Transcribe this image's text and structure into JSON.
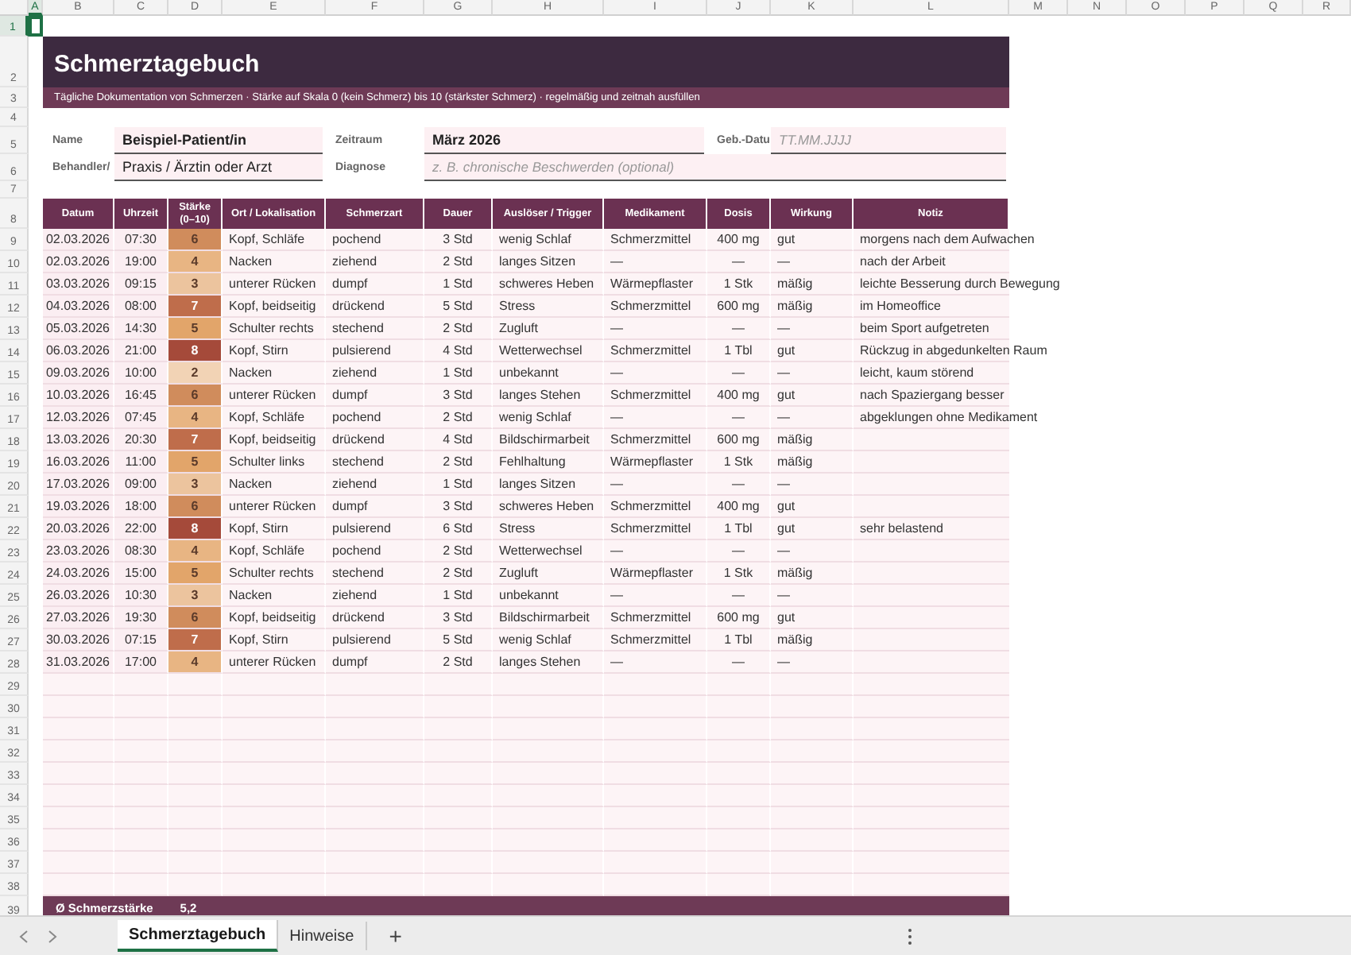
{
  "column_headers": [
    {
      "label": "A",
      "selected": true
    },
    {
      "label": "B",
      "selected": false
    },
    {
      "label": "C",
      "selected": false
    },
    {
      "label": "D",
      "selected": false
    },
    {
      "label": "E",
      "selected": false
    },
    {
      "label": "F",
      "selected": false
    },
    {
      "label": "G",
      "selected": false
    },
    {
      "label": "H",
      "selected": false
    },
    {
      "label": "I",
      "selected": false
    },
    {
      "label": "J",
      "selected": false
    },
    {
      "label": "K",
      "selected": false
    },
    {
      "label": "L",
      "selected": false
    },
    {
      "label": "M",
      "selected": false
    },
    {
      "label": "N",
      "selected": false
    },
    {
      "label": "O",
      "selected": false
    },
    {
      "label": "P",
      "selected": false
    },
    {
      "label": "Q",
      "selected": false
    },
    {
      "label": "R",
      "selected": false
    }
  ],
  "row_headers": [
    {
      "label": "1",
      "selected": true
    },
    {
      "label": "2",
      "selected": false
    },
    {
      "label": "3",
      "selected": false
    },
    {
      "label": "4",
      "selected": false
    },
    {
      "label": "5",
      "selected": false
    },
    {
      "label": "6",
      "selected": false
    },
    {
      "label": "7",
      "selected": false
    },
    {
      "label": "8",
      "selected": false
    },
    {
      "label": "9",
      "selected": false
    },
    {
      "label": "10",
      "selected": false
    },
    {
      "label": "11",
      "selected": false
    },
    {
      "label": "12",
      "selected": false
    },
    {
      "label": "13",
      "selected": false
    },
    {
      "label": "14",
      "selected": false
    },
    {
      "label": "15",
      "selected": false
    },
    {
      "label": "16",
      "selected": false
    },
    {
      "label": "17",
      "selected": false
    },
    {
      "label": "18",
      "selected": false
    },
    {
      "label": "19",
      "selected": false
    },
    {
      "label": "20",
      "selected": false
    },
    {
      "label": "21",
      "selected": false
    },
    {
      "label": "22",
      "selected": false
    },
    {
      "label": "23",
      "selected": false
    },
    {
      "label": "24",
      "selected": false
    },
    {
      "label": "25",
      "selected": false
    },
    {
      "label": "26",
      "selected": false
    },
    {
      "label": "27",
      "selected": false
    },
    {
      "label": "28",
      "selected": false
    },
    {
      "label": "29",
      "selected": false
    },
    {
      "label": "30",
      "selected": false
    },
    {
      "label": "31",
      "selected": false
    },
    {
      "label": "32",
      "selected": false
    },
    {
      "label": "33",
      "selected": false
    },
    {
      "label": "34",
      "selected": false
    },
    {
      "label": "35",
      "selected": false
    },
    {
      "label": "36",
      "selected": false
    },
    {
      "label": "37",
      "selected": false
    },
    {
      "label": "38",
      "selected": false
    },
    {
      "label": "39",
      "selected": false
    }
  ],
  "title": "Schmerztagebuch",
  "subtitle": "Tägliche Dokumentation von Schmerzen · Stärke auf Skala 0 (kein Schmerz) bis 10 (stärkster Schmerz) · regelmäßig und zeitnah ausfüllen",
  "info_rows": [
    [
      {
        "label": "Name",
        "value": "Beispiel-Patient/in",
        "emphasis": true
      },
      {
        "label": "Zeitraum",
        "value": "März 2026",
        "emphasis": true
      },
      {
        "label": "Geb.-Datu",
        "placeholder": "TT.MM.JJJJ"
      }
    ],
    [
      {
        "label": "Behandler/",
        "value": "Praxis / Ärztin oder Arzt",
        "emphasis": false
      },
      {
        "label": "Diagnose",
        "placeholder": "z. B. chronische Beschwerden (optional)"
      }
    ]
  ],
  "table": {
    "columns": [
      "Datum",
      "Uhrzeit",
      "Stärke (0–10)",
      "Ort / Lokalisation",
      "Schmerzart",
      "Dauer",
      "Auslöser / Trigger",
      "Medikament",
      "Dosis",
      "Wirkung",
      "Notiz"
    ],
    "rows": [
      {
        "color": "#d08c5c",
        "cells": [
          "02.03.2026",
          "07:30",
          "6",
          "Kopf, Schläfe",
          "pochend",
          "3 Std",
          "wenig Schlaf",
          "Schmerzmittel",
          "400 mg",
          "gut",
          "morgens nach dem Aufwachen"
        ]
      },
      {
        "color": "#e8b583",
        "cells": [
          "02.03.2026",
          "19:00",
          "4",
          "Nacken",
          "ziehend",
          "2 Std",
          "langes Sitzen",
          "—",
          "—",
          "—",
          "nach der Arbeit"
        ]
      },
      {
        "color": "#ecc49e",
        "cells": [
          "03.03.2026",
          "09:15",
          "3",
          "unterer Rücken",
          "dumpf",
          "1 Std",
          "schweres Heben",
          "Wärmepflaster",
          "1 Stk",
          "mäßig",
          "leichte Besserung durch Bewegung"
        ]
      },
      {
        "color": "#bf6d4b",
        "cells": [
          "04.03.2026",
          "08:00",
          "7",
          "Kopf, beidseitig",
          "drückend",
          "5 Std",
          "Stress",
          "Schmerzmittel",
          "600 mg",
          "mäßig",
          "im Homeoffice"
        ]
      },
      {
        "color": "#e2a56a",
        "cells": [
          "05.03.2026",
          "14:30",
          "5",
          "Schulter rechts",
          "stechend",
          "2 Std",
          "Zugluft",
          "—",
          "—",
          "—",
          "beim Sport aufgetreten"
        ]
      },
      {
        "color": "#a54a3a",
        "cells": [
          "06.03.2026",
          "21:00",
          "8",
          "Kopf, Stirn",
          "pulsierend",
          "4 Std",
          "Wetterwechsel",
          "Schmerzmittel",
          "1 Tbl",
          "gut",
          "Rückzug in abgedunkelten Raum"
        ]
      },
      {
        "color": "#f2d3b5",
        "cells": [
          "09.03.2026",
          "10:00",
          "2",
          "Nacken",
          "ziehend",
          "1 Std",
          "unbekannt",
          "—",
          "—",
          "—",
          "leicht, kaum störend"
        ]
      },
      {
        "color": "#d08c5c",
        "cells": [
          "10.03.2026",
          "16:45",
          "6",
          "unterer Rücken",
          "dumpf",
          "3 Std",
          "langes Stehen",
          "Schmerzmittel",
          "400 mg",
          "gut",
          "nach Spaziergang besser"
        ]
      },
      {
        "color": "#e8b583",
        "cells": [
          "12.03.2026",
          "07:45",
          "4",
          "Kopf, Schläfe",
          "pochend",
          "2 Std",
          "wenig Schlaf",
          "—",
          "—",
          "—",
          "abgeklungen ohne Medikament"
        ]
      },
      {
        "color": "#bf6d4b",
        "cells": [
          "13.03.2026",
          "20:30",
          "7",
          "Kopf, beidseitig",
          "drückend",
          "4 Std",
          "Bildschirmarbeit",
          "Schmerzmittel",
          "600 mg",
          "mäßig"
        ]
      },
      {
        "color": "#e2a56a",
        "cells": [
          "16.03.2026",
          "11:00",
          "5",
          "Schulter links",
          "stechend",
          "2 Std",
          "Fehlhaltung",
          "Wärmepflaster",
          "1 Stk",
          "mäßig"
        ]
      },
      {
        "color": "#ecc49e",
        "cells": [
          "17.03.2026",
          "09:00",
          "3",
          "Nacken",
          "ziehend",
          "1 Std",
          "langes Sitzen",
          "—",
          "—",
          "—"
        ]
      },
      {
        "color": "#d08c5c",
        "cells": [
          "19.03.2026",
          "18:00",
          "6",
          "unterer Rücken",
          "dumpf",
          "3 Std",
          "schweres Heben",
          "Schmerzmittel",
          "400 mg",
          "gut"
        ]
      },
      {
        "color": "#a54a3a",
        "cells": [
          "20.03.2026",
          "22:00",
          "8",
          "Kopf, Stirn",
          "pulsierend",
          "6 Std",
          "Stress",
          "Schmerzmittel",
          "1 Tbl",
          "gut",
          "sehr belastend"
        ]
      },
      {
        "color": "#e8b583",
        "cells": [
          "23.03.2026",
          "08:30",
          "4",
          "Kopf, Schläfe",
          "pochend",
          "2 Std",
          "Wetterwechsel",
          "—",
          "—",
          "—"
        ]
      },
      {
        "color": "#e2a56a",
        "cells": [
          "24.03.2026",
          "15:00",
          "5",
          "Schulter rechts",
          "stechend",
          "2 Std",
          "Zugluft",
          "Wärmepflaster",
          "1 Stk",
          "mäßig"
        ]
      },
      {
        "color": "#ecc49e",
        "cells": [
          "26.03.2026",
          "10:30",
          "3",
          "Nacken",
          "ziehend",
          "1 Std",
          "unbekannt",
          "—",
          "—",
          "—"
        ]
      },
      {
        "color": "#d08c5c",
        "cells": [
          "27.03.2026",
          "19:30",
          "6",
          "Kopf, beidseitig",
          "drückend",
          "3 Std",
          "Bildschirmarbeit",
          "Schmerzmittel",
          "600 mg",
          "gut"
        ]
      },
      {
        "color": "#bf6d4b",
        "cells": [
          "30.03.2026",
          "07:15",
          "7",
          "Kopf, Stirn",
          "pulsierend",
          "5 Std",
          "wenig Schlaf",
          "Schmerzmittel",
          "1 Tbl",
          "mäßig"
        ]
      },
      {
        "color": "#e8b583",
        "cells": [
          "31.03.2026",
          "17:00",
          "4",
          "unterer Rücken",
          "dumpf",
          "2 Std",
          "langes Stehen",
          "—",
          "—",
          "—"
        ]
      }
    ]
  },
  "summary": {
    "label": "Ø Schmerzstärke",
    "value": "5,2"
  },
  "sheet_tabs": [
    {
      "label": "Schmerztagebuch",
      "selected": true
    },
    {
      "label": "Hinweise",
      "selected": false
    }
  ],
  "add_tab": "+"
}
